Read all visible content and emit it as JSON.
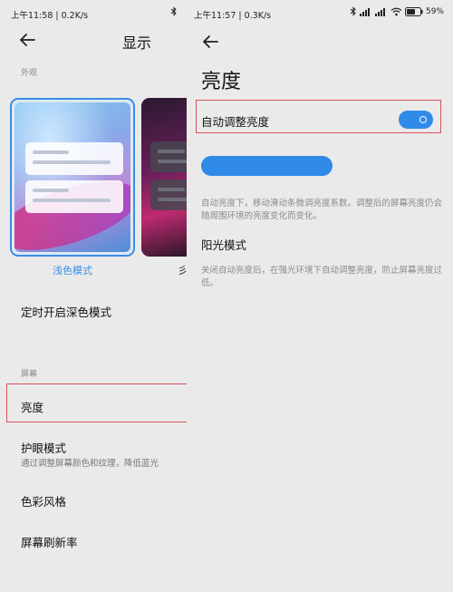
{
  "left": {
    "status_time": "上午11:58 | 0.2K/s",
    "title": "显示",
    "section_appearance": "外观",
    "theme_light_label": "浅色模式",
    "theme_dark_label_partial": "彡",
    "schedule_dark": "定时开启深色模式",
    "section_screen": "屏幕",
    "brightness": "亮度",
    "eye_care_title": "护眼模式",
    "eye_care_sub": "通过调整屏幕颜色和纹理，降低蓝光",
    "color_style": "色彩风格",
    "refresh_rate": "屏幕刷新率"
  },
  "right": {
    "status_time": "上午11:57 | 0.3K/s",
    "battery": "59",
    "title": "亮度",
    "auto_brightness": "自动调整亮度",
    "auto_brightness_on": true,
    "brightness_level": 0.5,
    "auto_desc": "自动亮度下，移动滑动条微调亮度系数。调整后的屏幕亮度仍会随周围环境的亮度变化而变化。",
    "sunlight_title": "阳光模式",
    "sunlight_desc": "关闭自动亮度后，在强光环境下自动调整亮度，防止屏幕亮度过低。"
  },
  "colors": {
    "accent": "#2f8ae8",
    "highlight_box": "#d9515b"
  }
}
